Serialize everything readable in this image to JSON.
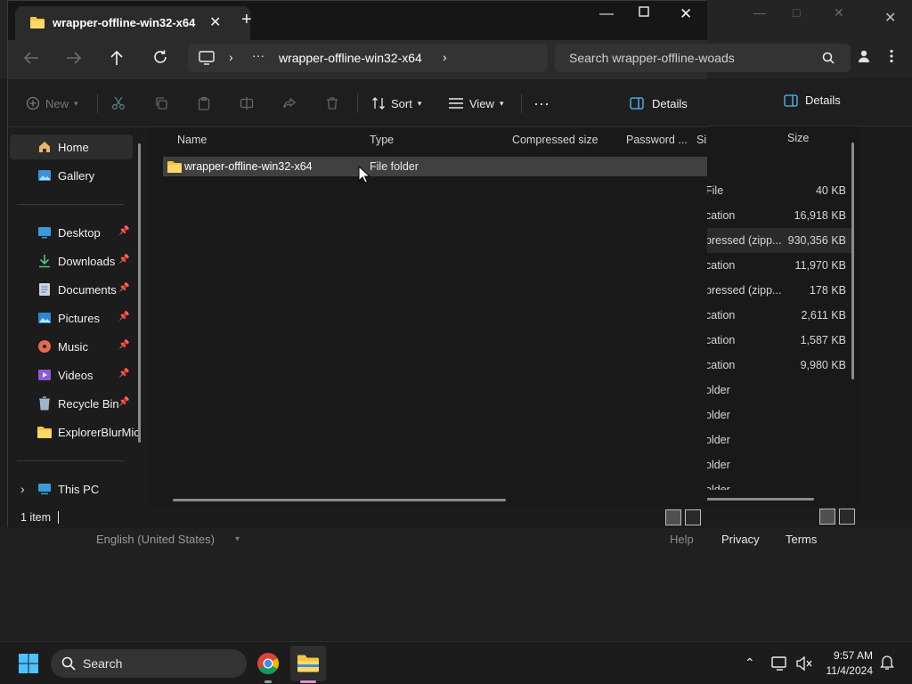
{
  "background_window": {
    "details_label": "Details",
    "size_header": "Size",
    "partial_header": "Si",
    "rows": [
      {
        "type": "File",
        "size": "40 KB"
      },
      {
        "type": "cation",
        "size": "16,918 KB"
      },
      {
        "type": "pressed (zipp...",
        "size": "930,356 KB"
      },
      {
        "type": "cation",
        "size": "11,970 KB"
      },
      {
        "type": "pressed (zipp...",
        "size": "178 KB"
      },
      {
        "type": "cation",
        "size": "2,611 KB"
      },
      {
        "type": "cation",
        "size": "1,587 KB"
      },
      {
        "type": "cation",
        "size": "9,980 KB"
      },
      {
        "type": "older",
        "size": ""
      },
      {
        "type": "older",
        "size": ""
      },
      {
        "type": "older",
        "size": ""
      },
      {
        "type": "older",
        "size": ""
      },
      {
        "type": "older",
        "size": ""
      }
    ],
    "footer": {
      "language": "English (United States)",
      "help": "Help",
      "privacy": "Privacy",
      "terms": "Terms"
    }
  },
  "explorer": {
    "tab_title": "wrapper-offline-win32-x64",
    "address": {
      "overflow": "···",
      "path": "wrapper-offline-win32-x64"
    },
    "search_placeholder": "Search wrapper-offline-w...ads",
    "search_text": "Search wrapper-offline-woads",
    "toolbar": {
      "new": "New",
      "sort": "Sort",
      "view": "View",
      "more": "···",
      "details": "Details"
    },
    "nav": {
      "home": "Home",
      "gallery": "Gallery",
      "desktop": "Desktop",
      "downloads": "Downloads",
      "documents": "Documents",
      "pictures": "Pictures",
      "music": "Music",
      "videos": "Videos",
      "recycle_bin": "Recycle Bin",
      "explorer_blur": "ExplorerBlurMica",
      "this_pc": "This PC"
    },
    "columns": {
      "name": "Name",
      "type": "Type",
      "compressed_size": "Compressed size",
      "password": "Password ...",
      "size_partial": "Si"
    },
    "files": [
      {
        "name": "wrapper-offline-win32-x64",
        "type": "File folder"
      }
    ],
    "status": {
      "count": "1 item"
    }
  },
  "taskbar": {
    "search_label": "Search",
    "time": "9:57 AM",
    "date": "11/4/2024"
  },
  "colors": {
    "accent_blue": "#4cc2ff",
    "folder_yellow": "#f4c542"
  }
}
